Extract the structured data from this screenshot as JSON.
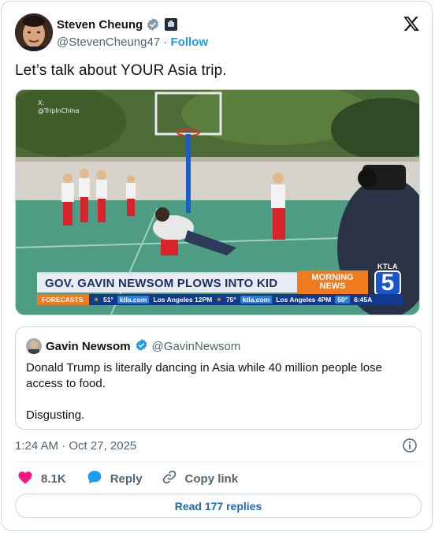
{
  "author": {
    "name": "Steven Cheung",
    "handle": "@StevenCheung47",
    "separator": "·",
    "follow_label": "Follow"
  },
  "tweet": {
    "text": "Let’s talk about YOUR Asia trip."
  },
  "media": {
    "watermark_line1": "X:",
    "watermark_line2": "@TripInChina",
    "chyron": "GOV. GAVIN NEWSOM PLOWS INTO KID",
    "morning_line1": "MORNING",
    "morning_line2": "NEWS",
    "station_label": "KTLA",
    "station_number": "5",
    "ticker": {
      "forecasts": "FORECASTS",
      "temp1": "51°",
      "site1": "ktla.com",
      "city_time1": "Los Angeles 12PM",
      "temp2": "75°",
      "site2": "ktla.com",
      "city_time2": "Los Angeles 4PM",
      "temp3": "50°",
      "clock": "6:45A"
    }
  },
  "quote": {
    "name": "Gavin Newsom",
    "handle": "@GavinNewsom",
    "text_line1": "Donald Trump is literally dancing in Asia while 40 million people lose access to food.",
    "text_line2": "Disgusting."
  },
  "timestamp": "1:24 AM · Oct 27, 2025",
  "actions": {
    "like_count": "8.1K",
    "reply_label": "Reply",
    "copy_label": "Copy link"
  },
  "read_replies_label": "Read 177 replies",
  "colors": {
    "accent": "#1d9bf0",
    "like": "#f91880",
    "chyron_text": "#1e2f66",
    "ticker_bg": "#123a8a",
    "orange": "#f07a1e"
  },
  "icons": [
    "verified-badge-icon",
    "affiliate-badge-icon",
    "x-logo-icon",
    "info-icon",
    "heart-icon",
    "reply-bubble-icon",
    "link-icon"
  ]
}
